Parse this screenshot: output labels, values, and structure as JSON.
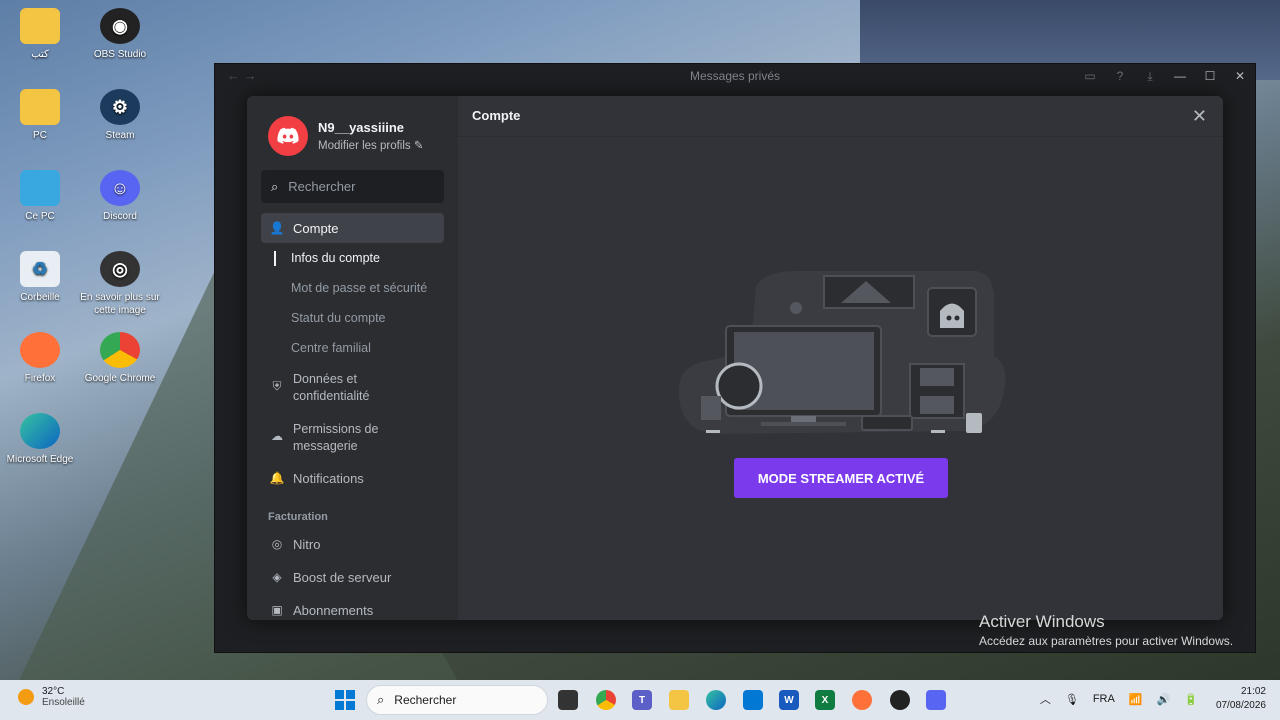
{
  "desktop": {
    "icons": [
      {
        "label": "كتب",
        "name": "folder-kutub"
      },
      {
        "label": "OBS Studio",
        "name": "obs-studio"
      },
      {
        "label": "PC",
        "name": "pc-folder"
      },
      {
        "label": "Steam",
        "name": "steam"
      },
      {
        "label": "Ce PC",
        "name": "this-pc"
      },
      {
        "label": "Discord",
        "name": "discord"
      },
      {
        "label": "Corbeille",
        "name": "recycle-bin"
      },
      {
        "label": "En savoir plus sur cette image",
        "name": "learn-about-image"
      },
      {
        "label": "Firefox",
        "name": "firefox"
      },
      {
        "label": "Google Chrome",
        "name": "google-chrome"
      },
      {
        "label": "Microsoft Edge",
        "name": "microsoft-edge"
      }
    ]
  },
  "window": {
    "title": "Messages privés"
  },
  "profile": {
    "username": "N9__yassiiine",
    "edit_label": "Modifier les profils ✎"
  },
  "sidebar": {
    "search_placeholder": "Rechercher",
    "account": "Compte",
    "account_sub": [
      "Infos du compte",
      "Mot de passe et sécurité",
      "Statut du compte",
      "Centre familial"
    ],
    "data_privacy_1": "Données et",
    "data_privacy_2": "confidentialité",
    "msg_perm_1": "Permissions de",
    "msg_perm_2": "messagerie",
    "notifications": "Notifications",
    "billing_head": "Facturation",
    "nitro": "Nitro",
    "server_boost": "Boost de serveur",
    "subscriptions": "Abonnements"
  },
  "main": {
    "title": "Compte",
    "streamer_button": "MODE STREAMER ACTIVÉ"
  },
  "activation": {
    "line1": "Activer Windows",
    "line2": "Accédez aux paramètres pour activer Windows."
  },
  "taskbar": {
    "temp": "32°C",
    "weather": "Ensoleillé",
    "search": "Rechercher",
    "lang": "FRA",
    "time": "21:02",
    "date": "07/08/2026"
  },
  "colors": {
    "accent_button": "#7c3aed",
    "sidebar_bg": "#2b2d31",
    "main_bg": "#313338"
  }
}
